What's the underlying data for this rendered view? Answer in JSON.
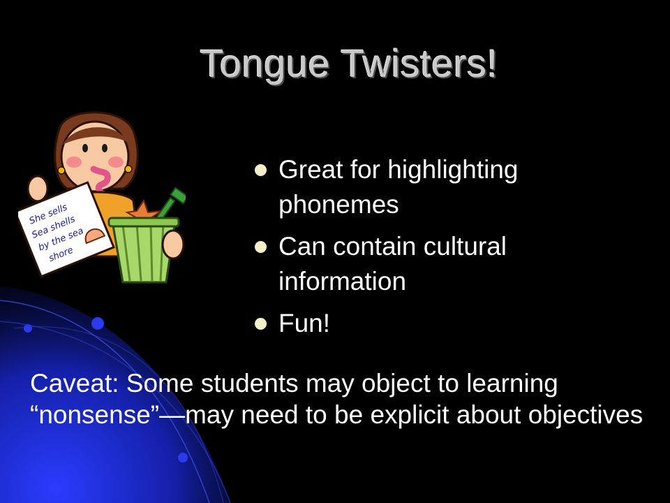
{
  "slide": {
    "title": "Tongue Twisters!",
    "bullets": [
      {
        "text": "Great for highlighting phonemes"
      },
      {
        "text": "Can contain cultural information"
      },
      {
        "text": "Fun!"
      }
    ],
    "caveat": "Caveat: Some students may object to learning “nonsense”—may need to be explicit about objectives"
  },
  "clipart": {
    "sign_lines": [
      "She sells",
      "Sea shells",
      "by the sea",
      "shore"
    ]
  },
  "colors": {
    "background": "#000000",
    "title": "#c8c8c8",
    "text": "#ffffff",
    "bullet": "#f3efc9",
    "swoosh_blue": "#1a28c8"
  }
}
